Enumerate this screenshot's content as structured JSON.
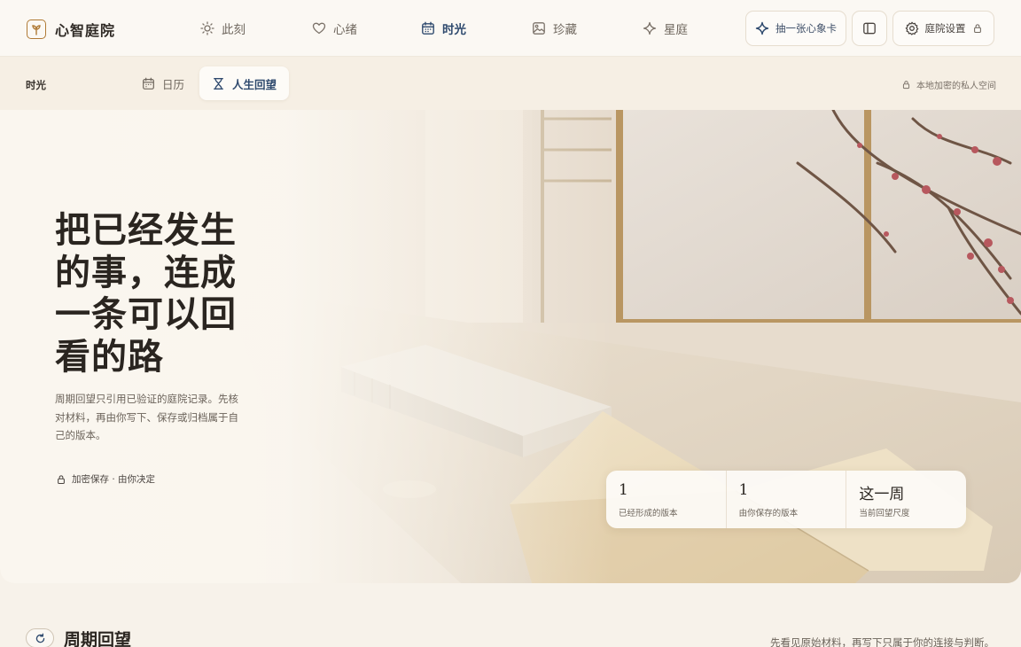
{
  "brand": {
    "name": "心智庭院"
  },
  "nav": {
    "items": [
      {
        "label": "此刻",
        "icon": "sun-icon"
      },
      {
        "label": "心绪",
        "icon": "heart-icon"
      },
      {
        "label": "时光",
        "icon": "calendar-icon",
        "active": true
      },
      {
        "label": "珍藏",
        "icon": "image-icon"
      },
      {
        "label": "星庭",
        "icon": "sparkle-icon"
      }
    ],
    "draw_card_label": "抽一张心象卡",
    "settings_label": "庭院设置"
  },
  "subnav": {
    "section_title": "时光",
    "tabs": [
      {
        "label": "日历",
        "icon": "calendar-icon"
      },
      {
        "label": "人生回望",
        "icon": "hourglass-icon",
        "active": true
      }
    ],
    "privacy_note": "本地加密的私人空间"
  },
  "hero": {
    "title": "把已经发生的事，连成一条可以回看的路",
    "description": "周期回望只引用已验证的庭院记录。先核对材料，再由你写下、保存或归档属于自己的版本。",
    "meta": "加密保存 · 由你决定",
    "stats": [
      {
        "value": "1",
        "label": "已经形成的版本"
      },
      {
        "value": "1",
        "label": "由你保存的版本"
      },
      {
        "value": "这一周",
        "label": "当前回望尺度"
      }
    ]
  },
  "section": {
    "title": "周期回望",
    "note": "先看见原始材料，再写下只属于你的连接与判断。"
  },
  "colors": {
    "accent": "#2f4a6e",
    "brand": "#b07a35",
    "background": "#f7f2ea"
  }
}
